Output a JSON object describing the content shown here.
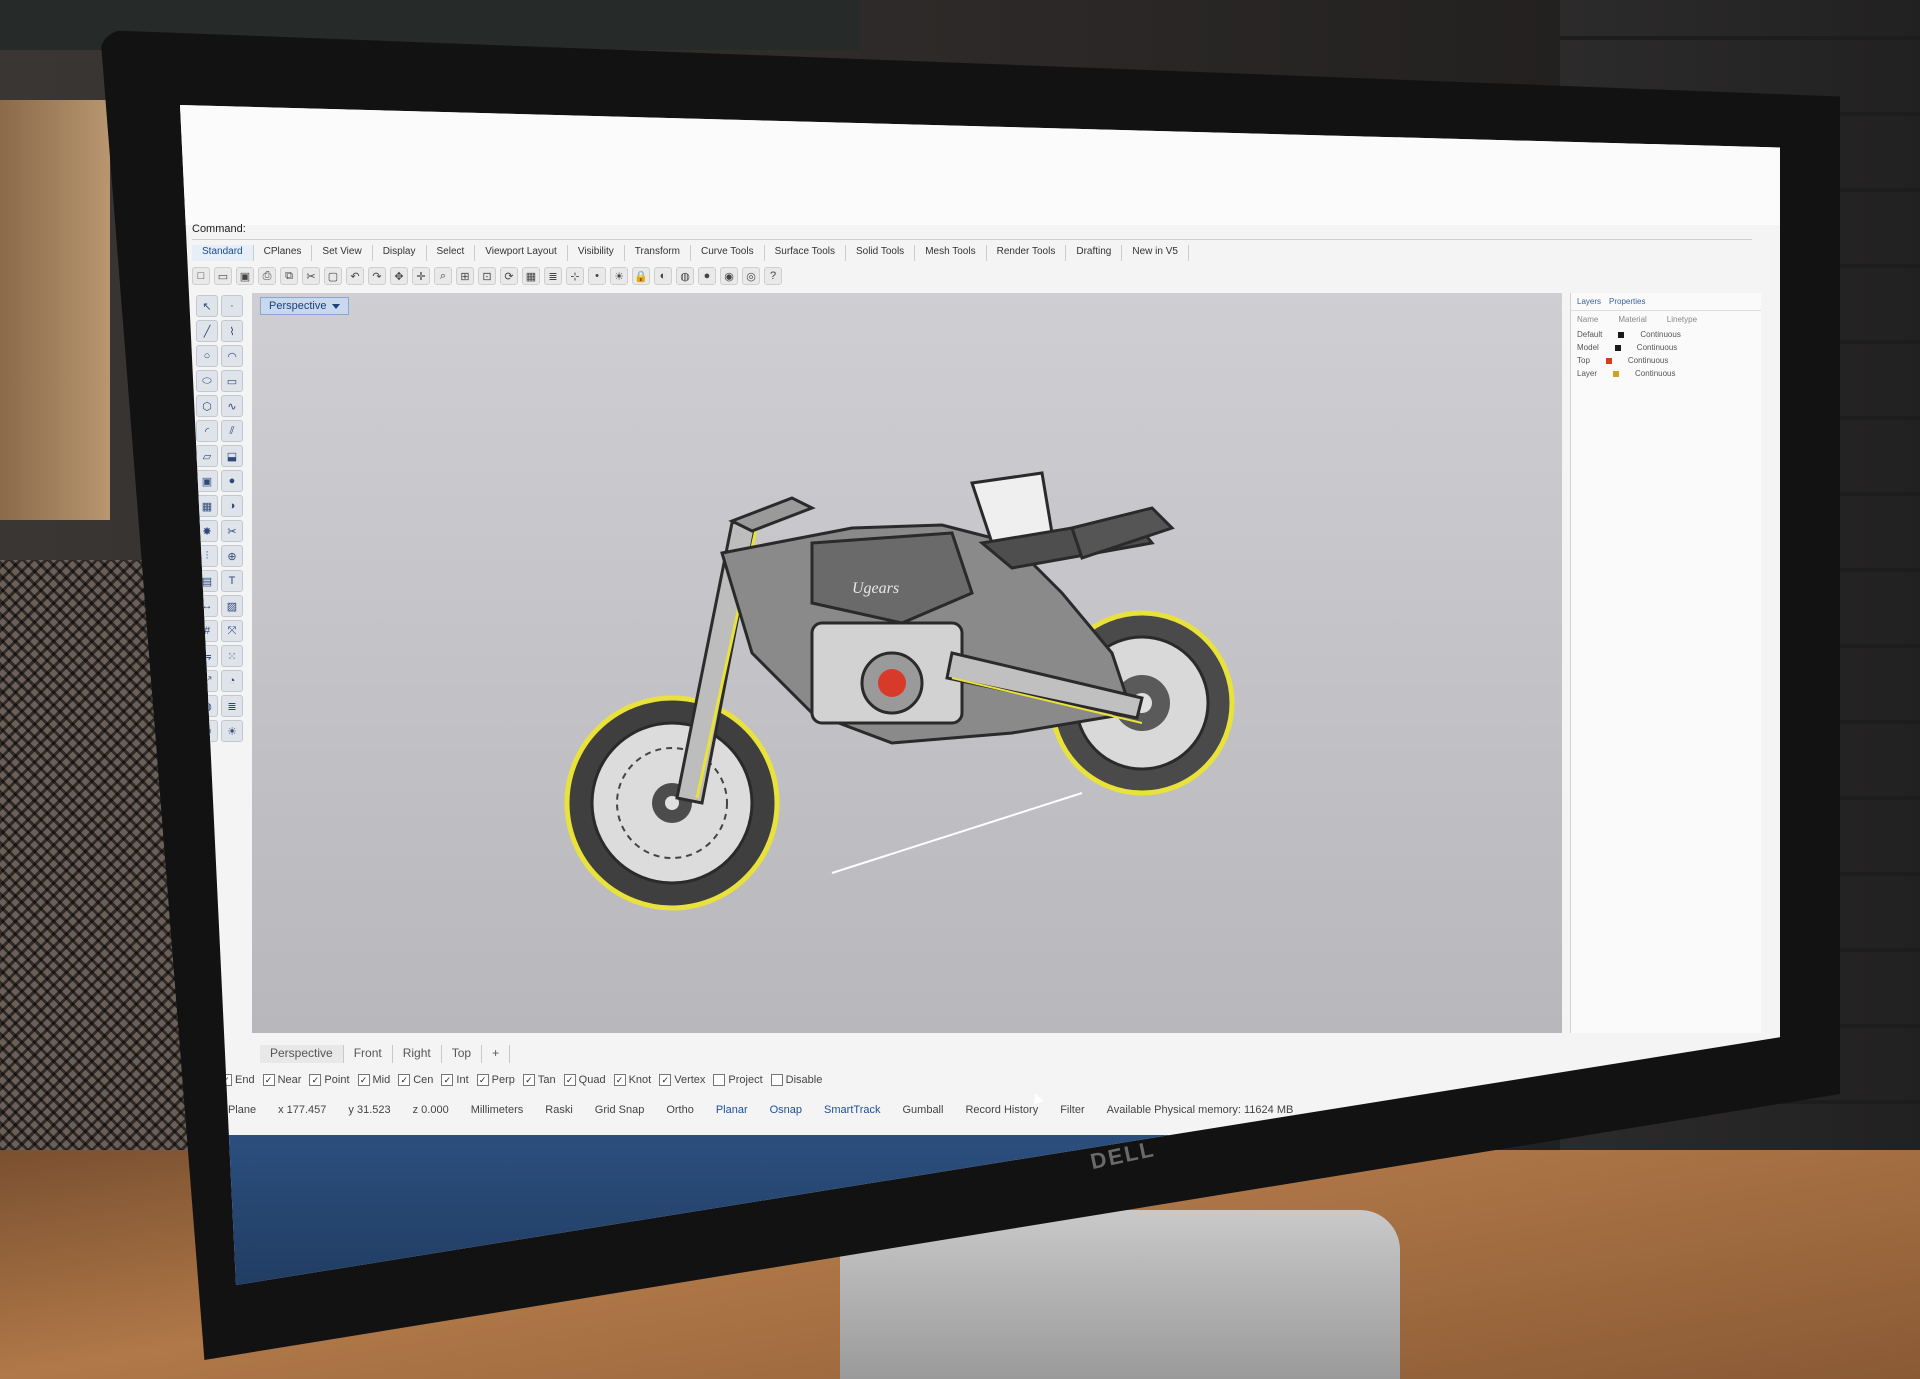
{
  "command": {
    "label": "Command:"
  },
  "toolbar_tabs": [
    {
      "label": "Standard",
      "active": true
    },
    {
      "label": "CPlanes"
    },
    {
      "label": "Set View"
    },
    {
      "label": "Display"
    },
    {
      "label": "Select"
    },
    {
      "label": "Viewport Layout"
    },
    {
      "label": "Visibility"
    },
    {
      "label": "Transform"
    },
    {
      "label": "Curve Tools"
    },
    {
      "label": "Surface Tools"
    },
    {
      "label": "Solid Tools"
    },
    {
      "label": "Mesh Tools"
    },
    {
      "label": "Render Tools"
    },
    {
      "label": "Drafting"
    },
    {
      "label": "New in V5"
    }
  ],
  "toolbar_icons": [
    "new-file-icon",
    "open-folder-icon",
    "save-icon",
    "print-icon",
    "copy-icon",
    "cut-icon",
    "paste-icon",
    "undo-icon",
    "redo-icon",
    "pan-icon",
    "move-icon",
    "zoom-icon",
    "zoom-window-icon",
    "zoom-extents-icon",
    "rotate-view-icon",
    "grid-icon",
    "layer-icon",
    "snap-icon",
    "point-icon",
    "light-icon",
    "lock-icon",
    "render-icon",
    "color-wheel-icon",
    "sphere-icon",
    "material-icon",
    "environment-icon",
    "help-icon"
  ],
  "left_tool_icons": [
    "select-arrow-icon",
    "point-icon",
    "line-icon",
    "polyline-icon",
    "circle-icon",
    "arc-icon",
    "ellipse-icon",
    "rectangle-icon",
    "polygon-icon",
    "curve-icon",
    "fillet-icon",
    "offset-icon",
    "surface-icon",
    "extrude-icon",
    "box-icon",
    "sphere-icon",
    "mesh-icon",
    "boolean-icon",
    "explode-icon",
    "trim-icon",
    "split-icon",
    "join-icon",
    "group-icon",
    "text-icon",
    "dimension-icon",
    "hatch-icon",
    "grid-icon",
    "transform-icon",
    "mirror-icon",
    "array-icon",
    "scale-icon",
    "analyze-icon",
    "render-icon",
    "layer-icon",
    "properties-icon",
    "light-icon"
  ],
  "viewport": {
    "name": "Perspective"
  },
  "viewport_tabs": [
    {
      "label": "Perspective",
      "active": true
    },
    {
      "label": "Front"
    },
    {
      "label": "Right"
    },
    {
      "label": "Top"
    },
    {
      "label": "+"
    }
  ],
  "osnaps": [
    {
      "label": "End",
      "checked": true
    },
    {
      "label": "Near",
      "checked": true
    },
    {
      "label": "Point",
      "checked": true
    },
    {
      "label": "Mid",
      "checked": true
    },
    {
      "label": "Cen",
      "checked": true
    },
    {
      "label": "Int",
      "checked": true
    },
    {
      "label": "Perp",
      "checked": true
    },
    {
      "label": "Tan",
      "checked": true
    },
    {
      "label": "Quad",
      "checked": true
    },
    {
      "label": "Knot",
      "checked": true
    },
    {
      "label": "Vertex",
      "checked": true
    },
    {
      "label": "Project",
      "checked": false
    },
    {
      "label": "Disable",
      "checked": false
    }
  ],
  "status": {
    "cplane": "CPlane",
    "x": "x 177.457",
    "y": "y 31.523",
    "z": "z 0.000",
    "units": "Millimeters",
    "layer": "Raski",
    "grid_snap": "Grid Snap",
    "ortho": "Ortho",
    "planar": "Planar",
    "osnap": "Osnap",
    "smarttrack": "SmartTrack",
    "gumball": "Gumball",
    "record_history": "Record History",
    "filter": "Filter",
    "memory": "Available Physical memory: 11624 MB"
  },
  "right_panel": {
    "tabs": [
      "Layers",
      "Properties"
    ],
    "columns": [
      "Name",
      "Material",
      "Linetype"
    ],
    "rows": [
      {
        "name": "Default",
        "color": "#1a1a1a",
        "linetype": "Continuous"
      },
      {
        "name": "Model",
        "color": "#1a1a1a",
        "linetype": "Continuous"
      },
      {
        "name": "Top",
        "color": "#d04020",
        "linetype": "Continuous"
      },
      {
        "name": "Layer",
        "color": "#d0a020",
        "linetype": "Continuous"
      }
    ]
  },
  "colors": {
    "selection_highlight": "#e8e23a",
    "viewport_bg": "#c6c6ca",
    "accent_red": "#d83a2a",
    "ui_blue": "#1d4fa0"
  },
  "model": {
    "logo_text": "Ugears"
  },
  "monitor": {
    "brand": "DELL"
  }
}
